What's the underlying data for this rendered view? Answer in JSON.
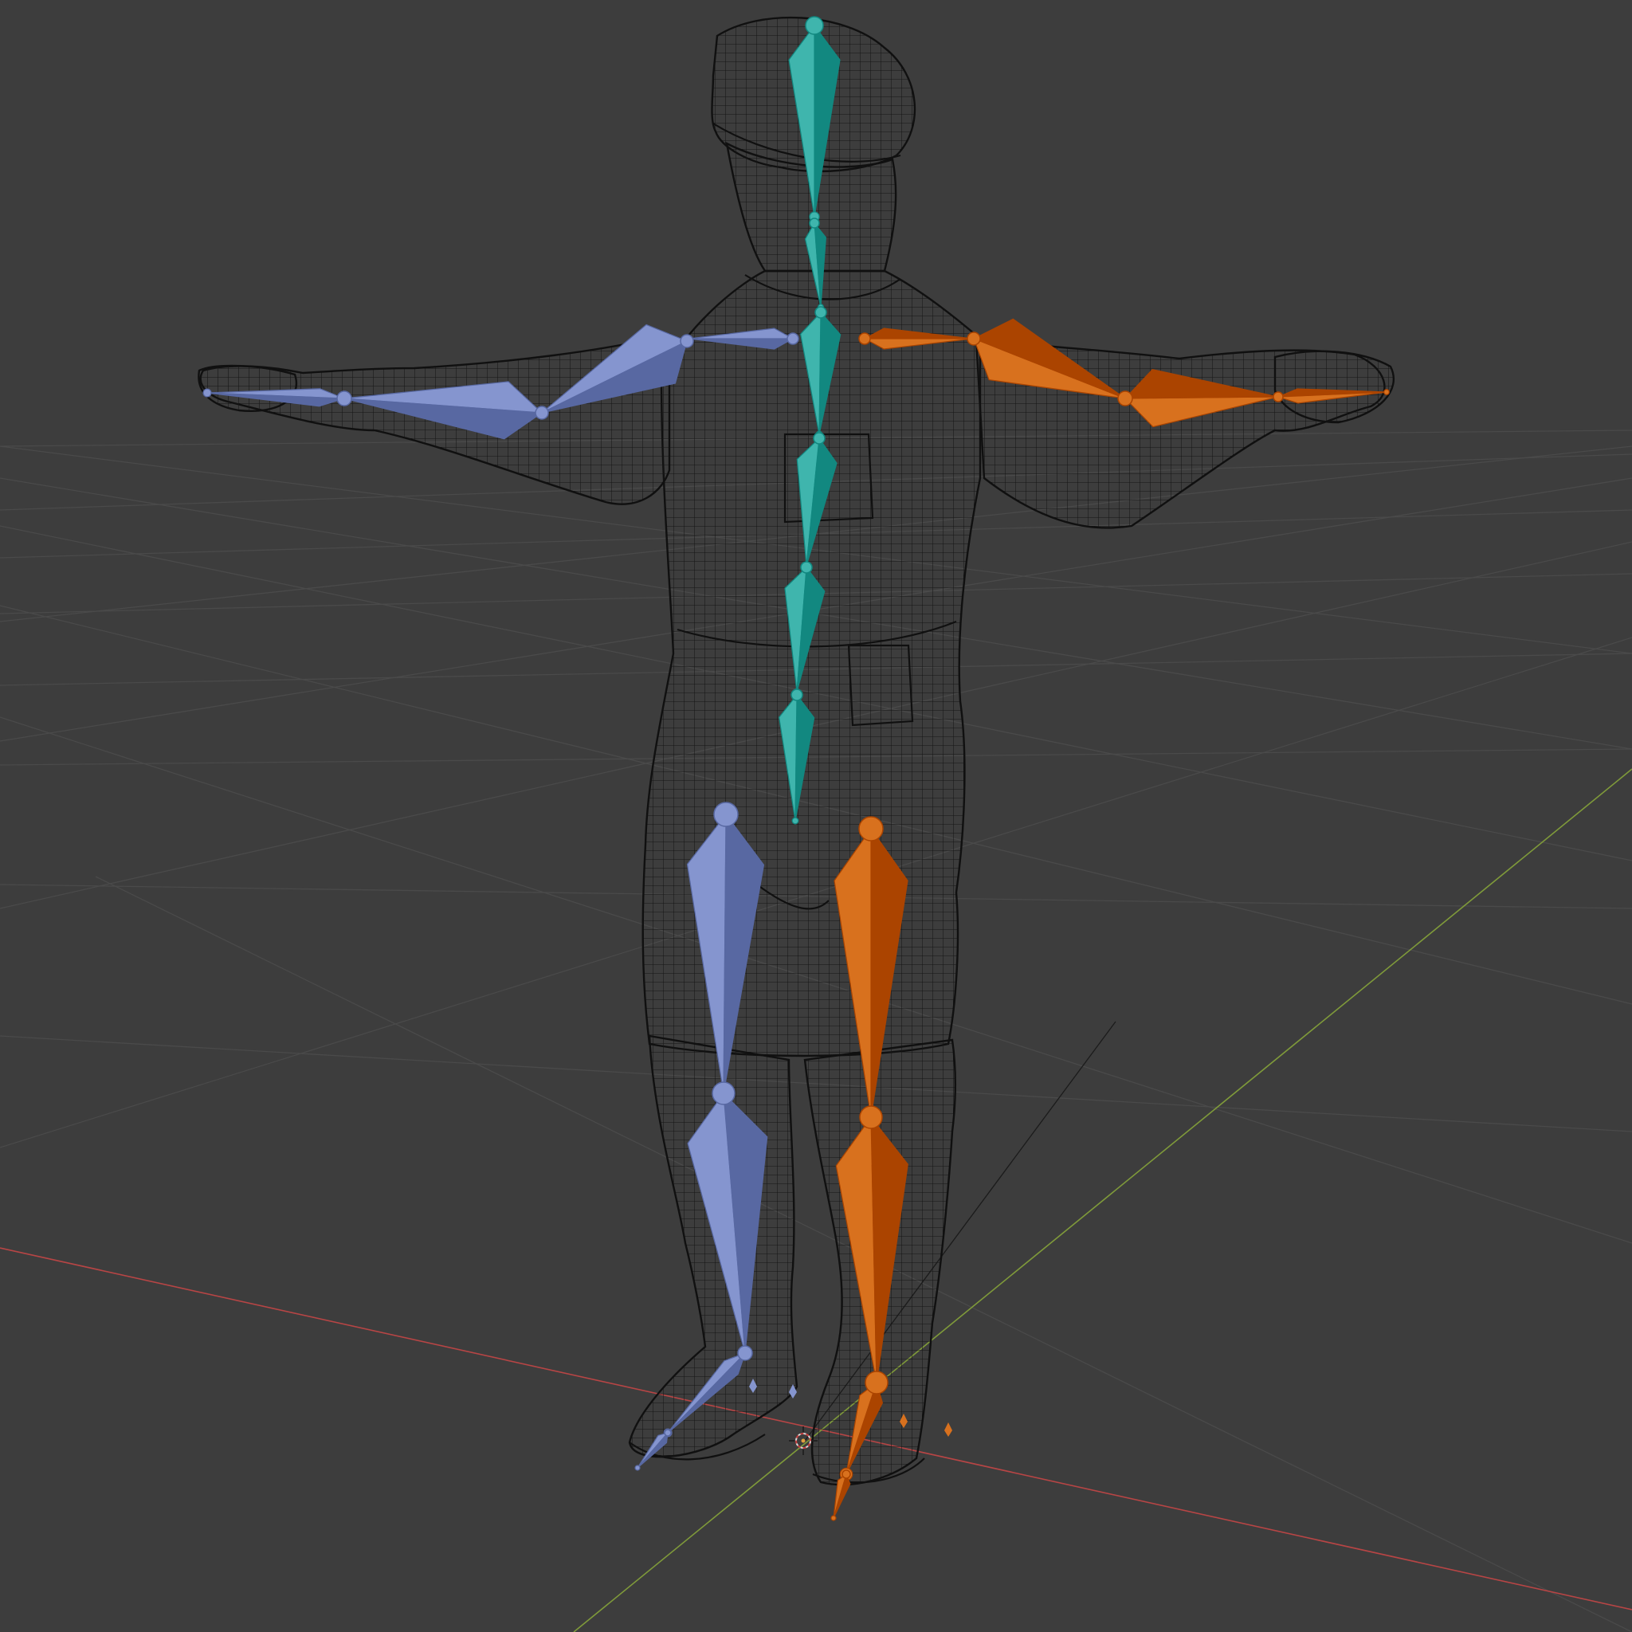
{
  "viewport": {
    "background": "#3d3d3d",
    "grid_color": "#4a4a4a",
    "x_axis_color": "#b74545",
    "y_axis_color": "#7f9a3a",
    "z_axis_color": "#202020",
    "wire_color": "#141414"
  },
  "armature": {
    "spine_color": "#3fb5ad",
    "left_side_color": "#8595cf",
    "right_side_color": "#d8711e"
  },
  "icons": {
    "origin": "3d-cursor-icon"
  }
}
